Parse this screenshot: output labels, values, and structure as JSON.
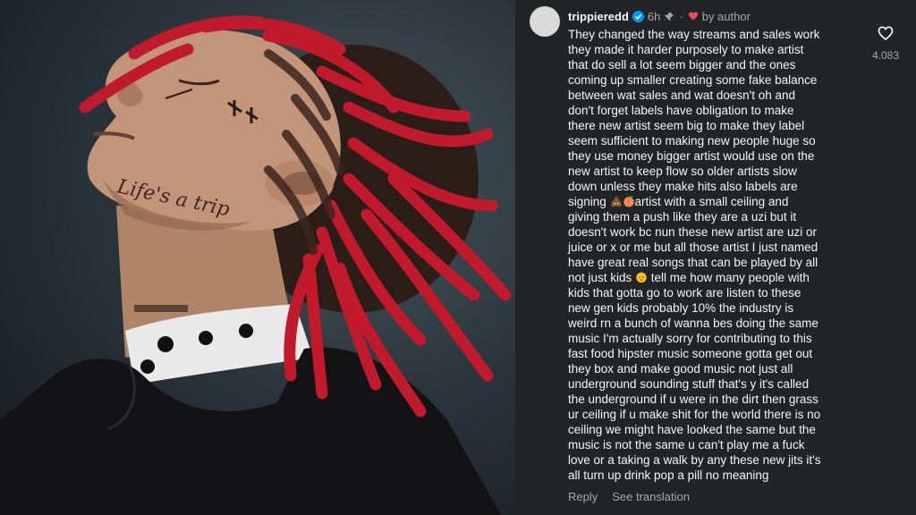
{
  "photo": {
    "tattoo_text": "Life's a trip"
  },
  "comment": {
    "username": "trippieredd",
    "time": "6h",
    "separator": "·",
    "liked_by_author": "by author",
    "like_count": "4.083",
    "lines": [
      "They changed the way streams and sales work",
      "they made it harder purposely to make artist",
      "that do sell a lot seem bigger and the ones",
      "coming up smaller creating some fake balance",
      "between wat sales and wat doesn't oh and",
      "don't forget labels have obligation to make",
      "there new artist seem big to make they label",
      "seem sufficient to making new people huge so",
      "they use money bigger artist would use on the",
      "new artist to keep flow so older artists slow",
      "down unless they make hits also labels are"
    ],
    "line12_before": "signing ",
    "line12_after": "artist with a small ceiling and",
    "lines_b": [
      "giving them a push like they are a uzi but it",
      "doesn't work bc nun these new artist are uzi or",
      "juice or x or me but all those artist I just named",
      "have great real songs that can be played by all"
    ],
    "line17_before": "not just kids ",
    "line17_after": " tell me how many people with",
    "lines_c": [
      "kids that gotta go to work are listen to these",
      "new gen kids probably 10% the industry is",
      "weird rn a bunch of wanna bes doing the same",
      "music I'm actually sorry for contributing to this",
      "fast food hipster music someone gotta get out",
      "they box and make good music not just all",
      "underground sounding stuff that's y it's called",
      "the underground if u were in the dirt then grass",
      "ur ceiling if u make shit for the world there is no",
      "ceiling we might have looked the same but the",
      "music is not the same u can't play me a fuck",
      "love or a taking a walk by any these new jits it's",
      "all turn up drink pop a pill no meaning"
    ],
    "reply_label": "Reply",
    "translation_label": "See translation"
  },
  "colors": {
    "background": "#232427",
    "text": "#f5f5f5",
    "muted": "#a8a8a8",
    "verified": "#0095f6",
    "heart": "#ed4956",
    "dreads": "#c01a2c"
  },
  "icons": [
    "verified-icon",
    "pin-icon",
    "heart-icon",
    "like-icon",
    "poop-emoji",
    "peach-emoji",
    "baby-emoji"
  ]
}
